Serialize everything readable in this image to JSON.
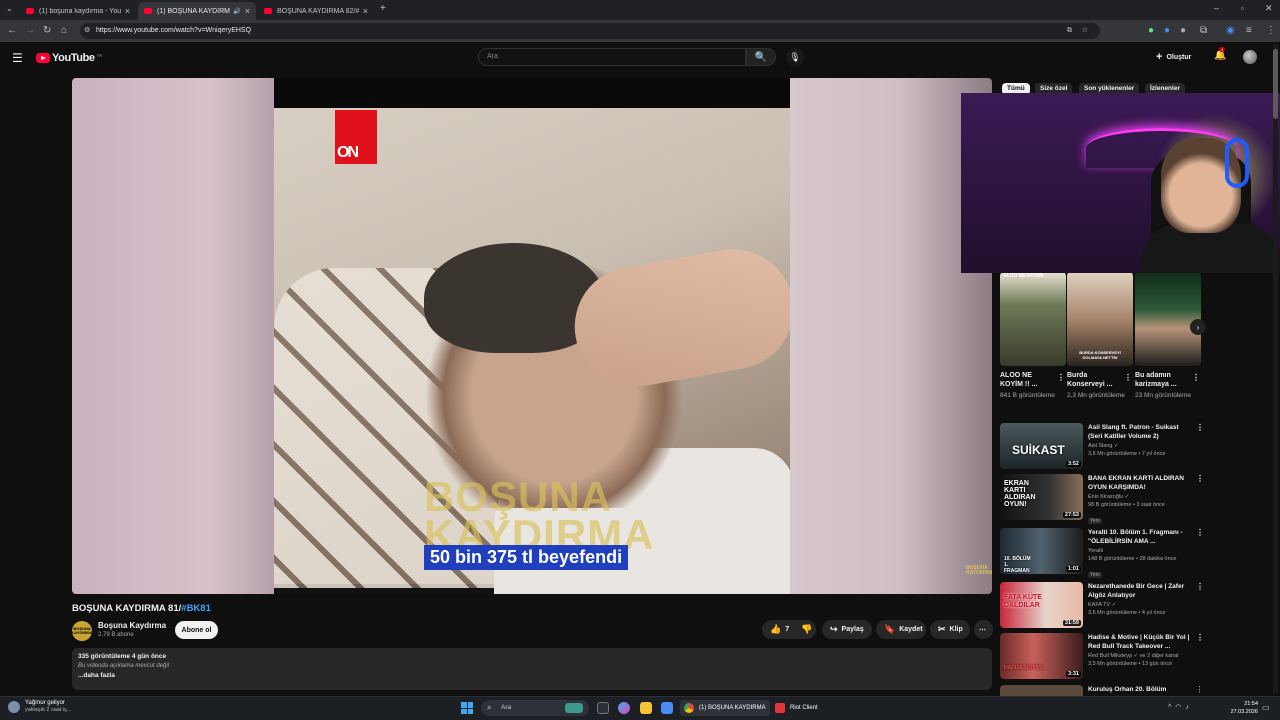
{
  "browser": {
    "tabs": [
      {
        "title": "(1) boşuna kaydırma - YouTube",
        "active": false
      },
      {
        "title": "(1) BOŞUNA KAYDIRMA 81",
        "active": true
      },
      {
        "title": "BOŞUNA KAYDIRMA 82/#BKS...",
        "active": false
      }
    ],
    "new_tab": "+",
    "url": "https://www.youtube.com/watch?v=WniqeryEHSQ"
  },
  "masthead": {
    "logo_text": "YouTube",
    "logo_country": "TR",
    "search_placeholder": "Ara",
    "create_label": "Oluştur",
    "notification_count": "1"
  },
  "video": {
    "news_logo": "ON",
    "watermark": "BOŞUNA KAYDIRMA",
    "subtitle": "50 bin 375 tl beyefendi",
    "corner_mark": "BOŞUNA KAYDIRMA",
    "title_main": "BOŞUNA KAYDIRMA 81/",
    "title_tag": "#BK81",
    "channel_name": "Boşuna Kaydırma",
    "channel_avatar_text": "BOŞUNA KAYDIRMA",
    "subscribers": "2,79 B abone",
    "subscribe_label": "Abone ol",
    "like_count": "7",
    "share_label": "Paylaş",
    "save_label": "Kaydet",
    "clip_label": "Klip",
    "more_label": "⋯",
    "stats": "335 görüntüleme  4 gün önce",
    "description": "Bu videoda açıklama mevcut değil",
    "show_more": "...daha fazla"
  },
  "chips": [
    "Tümü",
    "Size özel",
    "Son yüklenenler",
    "İzlenenler"
  ],
  "shelf": [
    {
      "title": "ALOO NE KOYİM !! ...",
      "views": "841 B görüntüleme",
      "thumb_caption": "ALOO NE KOYİM"
    },
    {
      "title": "Burda Konserveyi ...",
      "views": "2,3 Mn görüntüleme",
      "thumb_caption": "BURDA KONSERVEYİ DOLMAYA NETTİN"
    },
    {
      "title": "Bu adamın karizmaya ...",
      "views": "23 Mn görüntüleme",
      "thumb_caption": ""
    }
  ],
  "recommendations": [
    {
      "title": "Asil Slang ft. Patron - Suikast (Seri Katiller Volume 2)",
      "channel": "Asil Slang ✓",
      "meta": "3,6 Mn görüntüleme • 7 yıl önce",
      "duration": "3:52",
      "thumb_word": "SUİKAST",
      "badge": ""
    },
    {
      "title": "BANA EKRAN KARTI ALDIRAN OYUN KARŞIMDA!",
      "channel": "Enis Kirazoğlu ✓",
      "meta": "98 B görüntüleme • 3 saat önce",
      "duration": "27:53",
      "thumb_word": "EKRAN KARTI ALDIRAN OYUN!",
      "badge": "Yeni"
    },
    {
      "title": "Yeralti 10. Bölüm 1. Fragmanı - \"ÖLEBİLİRSİN AMA ...",
      "channel": "Yeralti",
      "meta": "148 B görüntüleme • 28 dakika önce",
      "duration": "1:01",
      "thumb_word": "10. BÖLÜM 1. FRAGMAN",
      "badge": "Yeni"
    },
    {
      "title": "Nezarethanede Bir Gece | Zafer Algöz Anlatıyor",
      "channel": "KAFA TV ✓",
      "meta": "3,6 Mn görüntüleme • 4 yıl önce",
      "duration": "31:59",
      "thumb_word": "FATA KÜTE DALDILAR",
      "badge": ""
    },
    {
      "title": "Hadise & Motive | Küçük Bir Yol | Red Bull Track Takeover ...",
      "channel": "Red Bull Miksteyp ✓ ve 2 diğer kanal",
      "meta": "3,5 Mn görüntüleme • 13 gün önce",
      "duration": "3:31",
      "thumb_word": "HADISE MOTIVE",
      "badge": ""
    },
    {
      "title": "Kuruluş Orhan 20. Bölüm",
      "channel": "",
      "meta": "",
      "duration": "",
      "thumb_word": "",
      "badge": ""
    }
  ],
  "taskbar": {
    "weather_title": "Yağmur geliyor",
    "weather_sub": "yaklaşık 2 saat iç...",
    "search_placeholder": "Ara",
    "chrome_label": "(1) BOŞUNA KAYDIRMA",
    "riot_label": "Riot Client",
    "time": "21:54",
    "date": "27.03.2026"
  },
  "colors": {
    "accent": "#ff0033",
    "link": "#3ea6ff",
    "subtitle_bg": "#1f3fbf"
  }
}
